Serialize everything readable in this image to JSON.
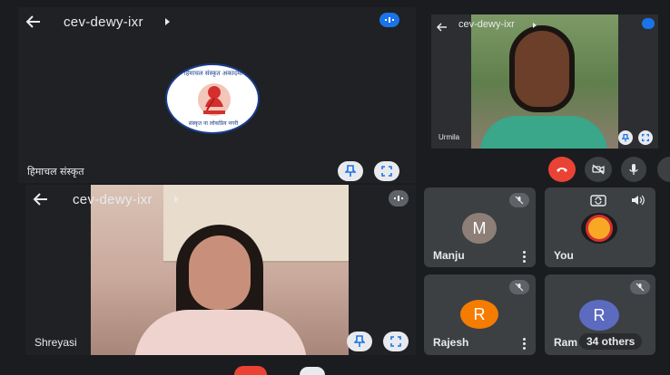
{
  "main_panel": {
    "code": "cev-dewy-ixr",
    "caption": "हिमाचल संस्कृत",
    "logo": {
      "top_text": "हिमाचल संस्कृत अकादमी",
      "bottom_text": "संस्कृत ना लोकप्रिय नगरी"
    }
  },
  "urmila_panel": {
    "code": "cev-dewy-ixr",
    "name": "Urmila"
  },
  "shreyasi_panel": {
    "code": "cev-dewy-ixr",
    "name": "Shreyasi"
  },
  "tiles": {
    "manju": {
      "initial": "M",
      "name": "Manju"
    },
    "you": {
      "name": "You"
    },
    "rajesh": {
      "initial": "R",
      "name": "Rajesh"
    },
    "ram": {
      "initial": "R",
      "name": "Ram"
    },
    "others": {
      "label": "34 others"
    }
  },
  "colors": {
    "hangup": "#ea4335",
    "accent": "#8ab4f8",
    "avatar_manju": "#8d7f78",
    "avatar_rajesh": "#f57c00",
    "avatar_ram": "#5c6bc0"
  }
}
